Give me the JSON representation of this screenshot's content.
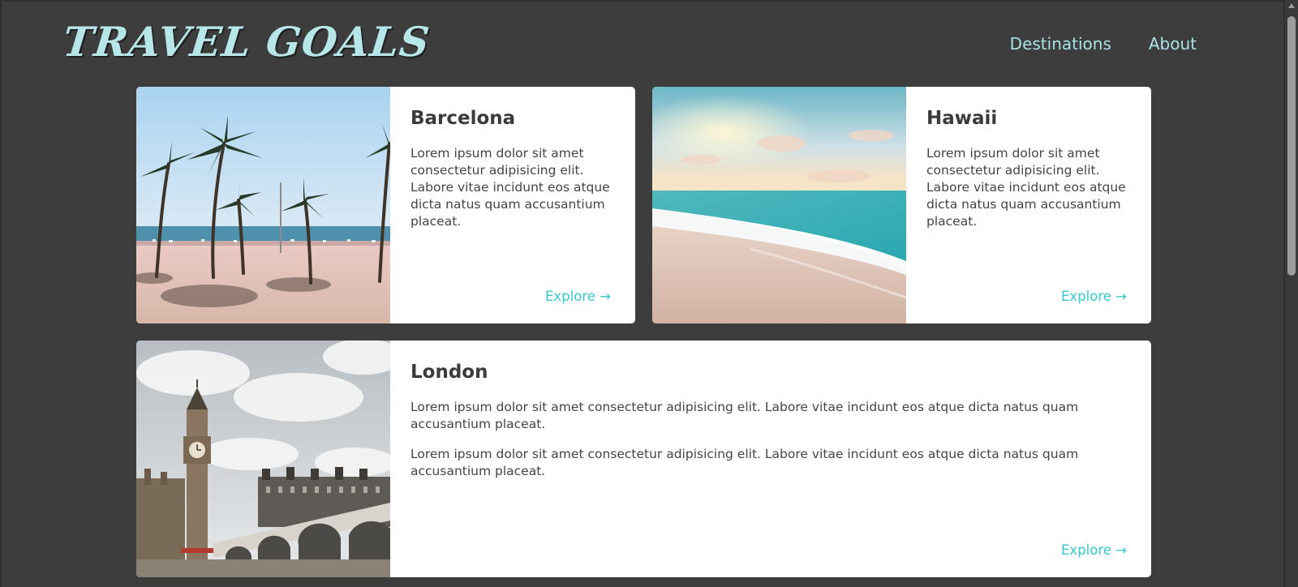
{
  "header": {
    "logo": "TRAVEL GOALS",
    "nav": [
      {
        "label": "Destinations"
      },
      {
        "label": "About"
      }
    ]
  },
  "cards": [
    {
      "title": "Barcelona",
      "paragraphs": [
        "Lorem ipsum dolor sit amet consectetur adipisicing elit. Labore vitae incidunt eos atque dicta natus quam accusantium placeat."
      ],
      "link": "Explore →"
    },
    {
      "title": "Hawaii",
      "paragraphs": [
        "Lorem ipsum dolor sit amet consectetur adipisicing elit. Labore vitae incidunt eos atque dicta natus quam accusantium placeat."
      ],
      "link": "Explore →"
    },
    {
      "title": "London",
      "paragraphs": [
        "Lorem ipsum dolor sit amet consectetur adipisicing elit. Labore vitae incidunt eos atque dicta natus quam accusantium placeat.",
        "Lorem ipsum dolor sit amet consectetur adipisicing elit. Labore vitae incidunt eos atque dicta natus quam accusantium placeat."
      ],
      "link": "Explore →"
    }
  ],
  "colors": {
    "page_background": "#3d3d3d",
    "logo": "#b6e6e8",
    "nav_link": "#a9e3e6",
    "card_background": "#ffffff",
    "heading": "#3b3b3b",
    "body_text": "#444444",
    "accent_link": "#35c7d3"
  }
}
